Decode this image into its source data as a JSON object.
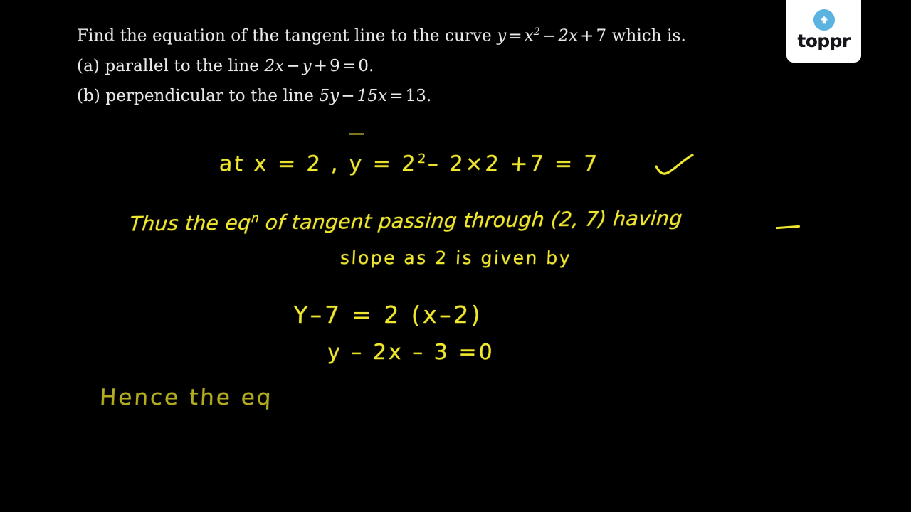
{
  "page": {
    "background_color": "#000000",
    "handwriting_color": "#efe62e",
    "question_text_color": "#e8e8e8"
  },
  "logo": {
    "name": "toppr",
    "wordmark": "toppr",
    "icon": "up-arrow-circle-icon",
    "circle_color": "#5bb3e0",
    "card_color": "#ffffff",
    "wordmark_color": "#16161a"
  },
  "question": {
    "line1": {
      "prefix": "Find the equation of the tangent line to the curve ",
      "math_y": "y",
      "math_eq": "=",
      "math_x": "x",
      "math_exp": "2",
      "math_minus": "−",
      "math_2x": "2x",
      "math_plus": "+",
      "math_7": "7",
      "suffix": " which is."
    },
    "line2": {
      "label": "(a) parallel to the line ",
      "math": "2x − y + 9 = 0",
      "math_a": "2x",
      "math_minus": "−",
      "math_b": "y",
      "math_plus": "+",
      "math_c": "9",
      "math_eq": "=",
      "math_d": "0",
      "period": "."
    },
    "line3": {
      "label": "(b) perpendicular to the line ",
      "math": "5y − 15x = 13",
      "math_a": "5y",
      "math_minus": "−",
      "math_b": "15x",
      "math_eq": "=",
      "math_c": "13",
      "period": "."
    }
  },
  "solution": {
    "lines": [
      {
        "id": "hw-line-1",
        "text_before_sup": "at  x = 2  ,  y =  2",
        "sup": "2",
        "text_after_sup": "–  2×2 +7    =  7",
        "has_check": true
      },
      {
        "id": "hw-line-2",
        "text_before_sup": "Thus  the  eq",
        "sup": "n",
        "text_after_sup": "  of   tangent   passing  through  (2, 7) having",
        "has_check": false
      },
      {
        "id": "hw-line-3",
        "text": "slope  as  2   is  given by"
      },
      {
        "id": "hw-line-4",
        "text": "Y–7  =  2 (x–2)"
      },
      {
        "id": "hw-line-5",
        "text": "y – 2x –  3 =0"
      },
      {
        "id": "hw-line-6",
        "text": "Hence   the   eq",
        "partial": true
      }
    ]
  }
}
